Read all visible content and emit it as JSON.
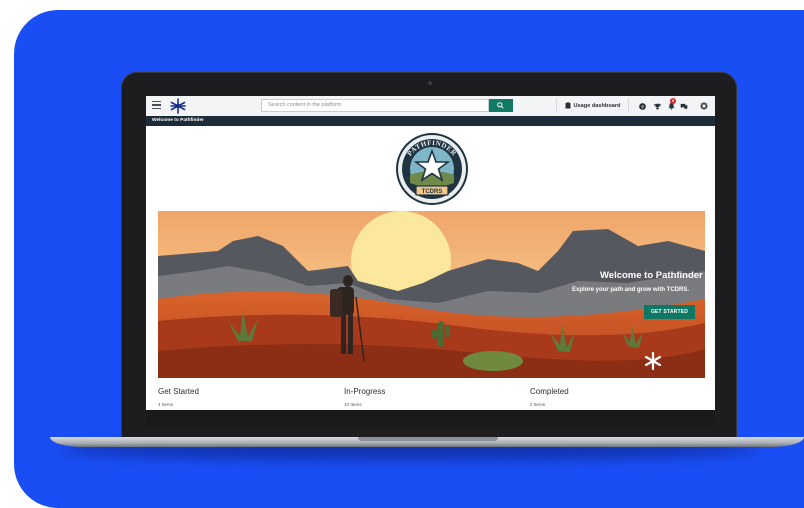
{
  "header": {
    "search_placeholder": "Search content in the platform",
    "usage_dashboard_label": "Usage dashboard",
    "notification_count": "9"
  },
  "breadcrumb": {
    "label": "Welcome to Pathfinder"
  },
  "logo": {
    "top_text": "PATHFINDER",
    "bottom_text": "TCDRS"
  },
  "hero": {
    "title": "Welcome to Pathfinder",
    "subtitle": "Explore your path and grow with TCDRS.",
    "cta_label": "GET STARTED"
  },
  "sections": [
    {
      "title": "Get Started",
      "count": "4 Items"
    },
    {
      "title": "In-Progress",
      "count": "10 Items"
    },
    {
      "title": "Completed",
      "count": "2 Items"
    }
  ],
  "colors": {
    "background_blue": "#1a4ef5",
    "accent_green": "#117a65",
    "nav_dark": "#1e2b38",
    "badge_red": "#d0282e"
  }
}
